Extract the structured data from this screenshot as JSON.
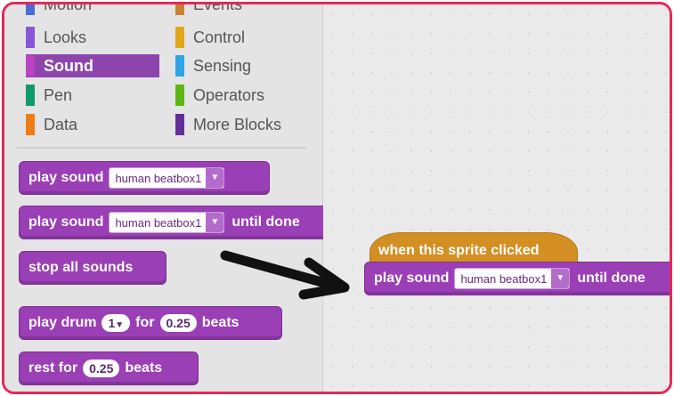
{
  "categories": {
    "left": [
      {
        "label": "Motion",
        "color": "#4a6cd4",
        "selected": false
      },
      {
        "label": "Looks",
        "color": "#8a55d7",
        "selected": false
      },
      {
        "label": "Sound",
        "color": "#bb42c3",
        "selected": true
      },
      {
        "label": "Pen",
        "color": "#0e9a6c",
        "selected": false
      },
      {
        "label": "Data",
        "color": "#ee7d16",
        "selected": false
      }
    ],
    "right": [
      {
        "label": "Events",
        "color": "#c88330",
        "selected": false
      },
      {
        "label": "Control",
        "color": "#e1a91a",
        "selected": false
      },
      {
        "label": "Sensing",
        "color": "#2ca5e2",
        "selected": false
      },
      {
        "label": "Operators",
        "color": "#5cb712",
        "selected": false
      },
      {
        "label": "More Blocks",
        "color": "#632d99",
        "selected": false
      }
    ]
  },
  "palette_blocks": {
    "play_sound": {
      "text": "play sound",
      "sound": "human beatbox1"
    },
    "play_sound_until": {
      "text": "play sound",
      "sound": "human beatbox1",
      "suffix": "until done"
    },
    "stop_all": {
      "text": "stop all sounds"
    },
    "play_drum": {
      "text": "play drum",
      "drum": "1",
      "mid": "for",
      "beats": "0.25",
      "suffix": "beats"
    },
    "rest": {
      "text": "rest for",
      "beats": "0.25",
      "suffix": "beats"
    }
  },
  "script": {
    "hat": "when this sprite clicked",
    "block_text": "play sound",
    "sound": "human beatbox1",
    "suffix": "until done"
  },
  "colors": {
    "frame": "#e8275a",
    "sound_block": "#9a3fb5",
    "event_block": "#d48f23"
  }
}
